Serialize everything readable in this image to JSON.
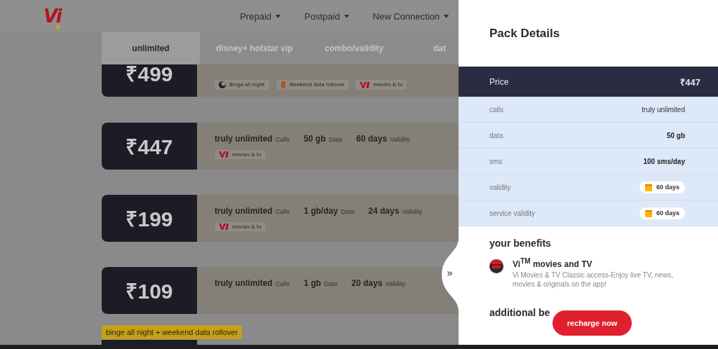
{
  "header": {
    "logo": "Vi",
    "nav": [
      "Prepaid",
      "Postpaid",
      "New Connection"
    ]
  },
  "tabs": [
    {
      "label": "unlimited",
      "selected": true
    },
    {
      "label": "disney+ hotstar vip",
      "selected": false
    },
    {
      "label": "combo/validity",
      "selected": false
    },
    {
      "label": "dat",
      "selected": false
    }
  ],
  "packs": [
    {
      "price": "₹499",
      "chips": [
        {
          "kind": "moon",
          "text": "Binge all night"
        },
        {
          "kind": "rollover",
          "text": "Weekend data rollover"
        },
        {
          "kind": "vi",
          "text": "movies & tv"
        }
      ]
    },
    {
      "price": "₹447",
      "features": [
        {
          "value": "truly unlimited",
          "label": "Calls"
        },
        {
          "value": "50 gb",
          "label": "Data"
        },
        {
          "value": "60 days",
          "label": "Validity"
        }
      ],
      "chips": [
        {
          "kind": "vi",
          "text": "movies & tv"
        }
      ]
    },
    {
      "price": "₹199",
      "features": [
        {
          "value": "truly unlimited",
          "label": "Calls"
        },
        {
          "value": "1 gb/day",
          "label": "Data"
        },
        {
          "value": "24 days",
          "label": "Validity"
        }
      ],
      "chips": [
        {
          "kind": "vi",
          "text": "movies & tv"
        }
      ]
    },
    {
      "price": "₹109",
      "features": [
        {
          "value": "truly unlimited",
          "label": "Calls"
        },
        {
          "value": "1 gb",
          "label": "Data"
        },
        {
          "value": "20 days",
          "label": "Validity"
        }
      ]
    },
    {
      "tag": "binge all night + weekend data rollover"
    }
  ],
  "details": {
    "title": "Pack Details",
    "price_label": "Price",
    "price": "₹447",
    "rows": [
      {
        "kind": "plain",
        "label": "calls",
        "value": "truly unlimited"
      },
      {
        "kind": "bold",
        "label": "data",
        "value": "50 gb"
      },
      {
        "kind": "bold",
        "label": "sms",
        "value": "100 sms/day"
      },
      {
        "kind": "calendar",
        "label": "validity",
        "value": "60 days"
      },
      {
        "kind": "calendar",
        "label": "service validity",
        "value": "60 days"
      }
    ],
    "benefits_title": "your benefits",
    "benefits": [
      {
        "title": "Vi$^{TM}$ movies and TV",
        "text": "Vi Movies & TV Classic access-Enjoy live TV, news, movies & originals on the app!"
      }
    ],
    "additional_title": "additional be",
    "collapse": "»",
    "cta": "recharge now"
  }
}
